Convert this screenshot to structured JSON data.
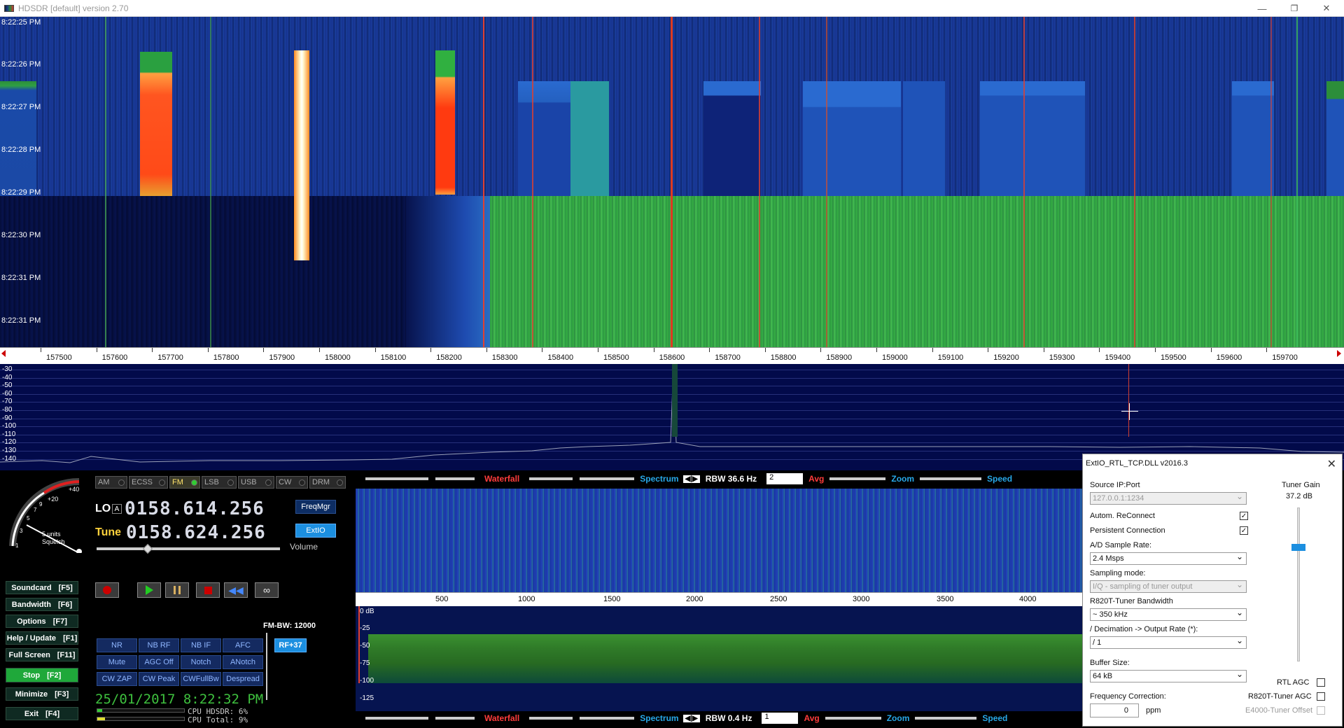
{
  "window": {
    "title": "HDSDR [default]  version 2.70",
    "minimize": "—",
    "restore": "❐",
    "close": "✕"
  },
  "waterfall": {
    "timestamps": [
      "8:22:25 PM",
      "8:22:26 PM",
      "8:22:27 PM",
      "8:22:28 PM",
      "8:22:29 PM",
      "8:22:30 PM",
      "8:22:31 PM",
      "8:22:31 PM"
    ]
  },
  "freq_axis": {
    "ticks": [
      "157500",
      "157600",
      "157700",
      "157800",
      "157900",
      "158000",
      "158100",
      "158200",
      "158300",
      "158400",
      "158500",
      "158600",
      "158700",
      "158800",
      "158900",
      "159000",
      "159100",
      "159200",
      "159300",
      "159400",
      "159500",
      "159600",
      "159700"
    ]
  },
  "spectrum": {
    "db_labels": [
      "-30",
      "-40",
      "-50",
      "-60",
      "-70",
      "-80",
      "-90",
      "-100",
      "-110",
      "-120",
      "-130",
      "-140"
    ]
  },
  "smeter": {
    "scale_plus20": "+20",
    "scale_plus40": "+40",
    "units": "5 units",
    "squelch": "Squelch",
    "nums": [
      "1",
      "3",
      "5",
      "7",
      "9"
    ]
  },
  "modes": [
    {
      "label": "AM",
      "on": false
    },
    {
      "label": "ECSS",
      "on": false
    },
    {
      "label": "FM",
      "on": true
    },
    {
      "label": "LSB",
      "on": false
    },
    {
      "label": "USB",
      "on": false
    },
    {
      "label": "CW",
      "on": false
    },
    {
      "label": "DRM",
      "on": false
    }
  ],
  "lo": {
    "label": "LO",
    "mark": "A",
    "value": "0158.614.256"
  },
  "tune": {
    "label": "Tune",
    "value": "0158.624.256"
  },
  "freqmgr": "FreqMgr",
  "extio": "ExtIO",
  "volume": "Volume",
  "left_buttons": [
    {
      "label": "Soundcard",
      "key": "[F5]"
    },
    {
      "label": "Bandwidth",
      "key": "[F6]"
    },
    {
      "label": "Options",
      "key": "[F7]"
    },
    {
      "label": "Help / Update",
      "key": "[F1]"
    },
    {
      "label": "Full Screen",
      "key": "[F11]"
    },
    {
      "label": "Stop",
      "key": "[F2]"
    },
    {
      "label": "Minimize",
      "key": "[F3]"
    },
    {
      "label": "Exit",
      "key": "[F4]"
    }
  ],
  "dsp": [
    [
      "NR",
      "NB RF",
      "NB IF",
      "AFC"
    ],
    [
      "Mute",
      "AGC Off",
      "Notch",
      "ANotch"
    ],
    [
      "CW ZAP",
      "CW Peak",
      "CWFullBw",
      "Despread"
    ]
  ],
  "fm_bw": "FM-BW: 12000",
  "rf": "RF+37",
  "datetime": "25/01/2017 8:22:32 PM",
  "cpu": {
    "hdsdr": "CPU HDSDR:  6%",
    "total": "CPU Total:  9%"
  },
  "ctrl_top": {
    "waterfall": "Waterfall",
    "spectrum": "Spectrum",
    "rbw": "RBW 36.6 Hz",
    "avg_val": "2",
    "avg": "Avg",
    "zoom": "Zoom",
    "speed": "Speed"
  },
  "ctrl_bottom": {
    "waterfall": "Waterfall",
    "spectrum": "Spectrum",
    "rbw": "RBW   0.4 Hz",
    "avg_val": "1",
    "avg": "Avg",
    "zoom": "Zoom",
    "speed": "Speed"
  },
  "zoom_axis": [
    "500",
    "1000",
    "1500",
    "2000",
    "2500",
    "3000",
    "3500",
    "4000"
  ],
  "zoom_db": [
    "0 dB",
    "-25",
    "-50",
    "-75",
    "-100",
    "-125"
  ],
  "dialog": {
    "title": "ExtIO_RTL_TCP.DLL v2016.3",
    "close": "✕",
    "source_lbl": "Source IP:Port",
    "source_val": "127.0.0.1:1234",
    "reconnect": "Autom. ReConnect",
    "persistent": "Persistent Connection",
    "ad_lbl": "A/D Sample Rate:",
    "ad_val": "2.4 Msps",
    "samp_lbl": "Sampling mode:",
    "samp_val": "I/Q - sampling of tuner output",
    "bw_lbl": "R820T-Tuner Bandwidth",
    "bw_val": "~ 350 kHz",
    "dec_lbl": "/ Decimation -> Output Rate (*):",
    "dec_val": "/ 1",
    "buf_lbl": "Buffer Size:",
    "buf_val": "64 kB",
    "fc_lbl": "Frequency Correction:",
    "fc_val": "0",
    "ppm": "ppm",
    "gain_lbl": "Tuner Gain",
    "gain_val": "37.2  dB",
    "rtl_agc": "RTL AGC",
    "r820_agc": "R820T-Tuner AGC",
    "e4000": "E4000-Tuner Offset",
    "check": "✓"
  }
}
